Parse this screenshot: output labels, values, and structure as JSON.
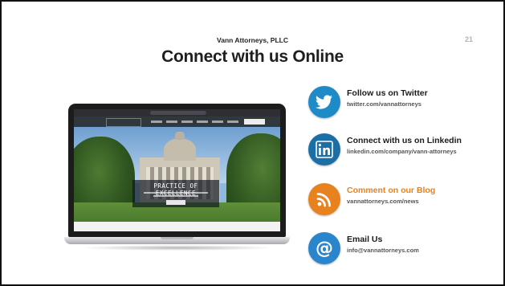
{
  "slide": {
    "org": "Vann Attorneys, PLLC",
    "title": "Connect with us Online",
    "page_number": "21"
  },
  "laptop": {
    "hero_title": "PRACTICE OF EXCELLENCE"
  },
  "contacts": [
    {
      "label": "Follow us on Twitter",
      "url": "twitter.com/vannattorneys",
      "icon": "twitter-bird-icon",
      "color": "#1f8ac8",
      "label_color": "#1b1b1b"
    },
    {
      "label": "Connect with us on Linkedin",
      "url": "linkedin.com/company/vann-attorneys",
      "icon": "linkedin-icon",
      "color": "#1c6ea6",
      "label_color": "#1b1b1b"
    },
    {
      "label": "Comment on our Blog",
      "url": "vannattorneys.com/news",
      "icon": "rss-feed-icon",
      "color": "#e8821e",
      "label_color": "#e8821e"
    },
    {
      "label": "Email Us",
      "url": "info@vannattorneys.com",
      "icon": "at-sign-icon",
      "color": "#2a86cc",
      "label_color": "#1b1b1b"
    }
  ]
}
